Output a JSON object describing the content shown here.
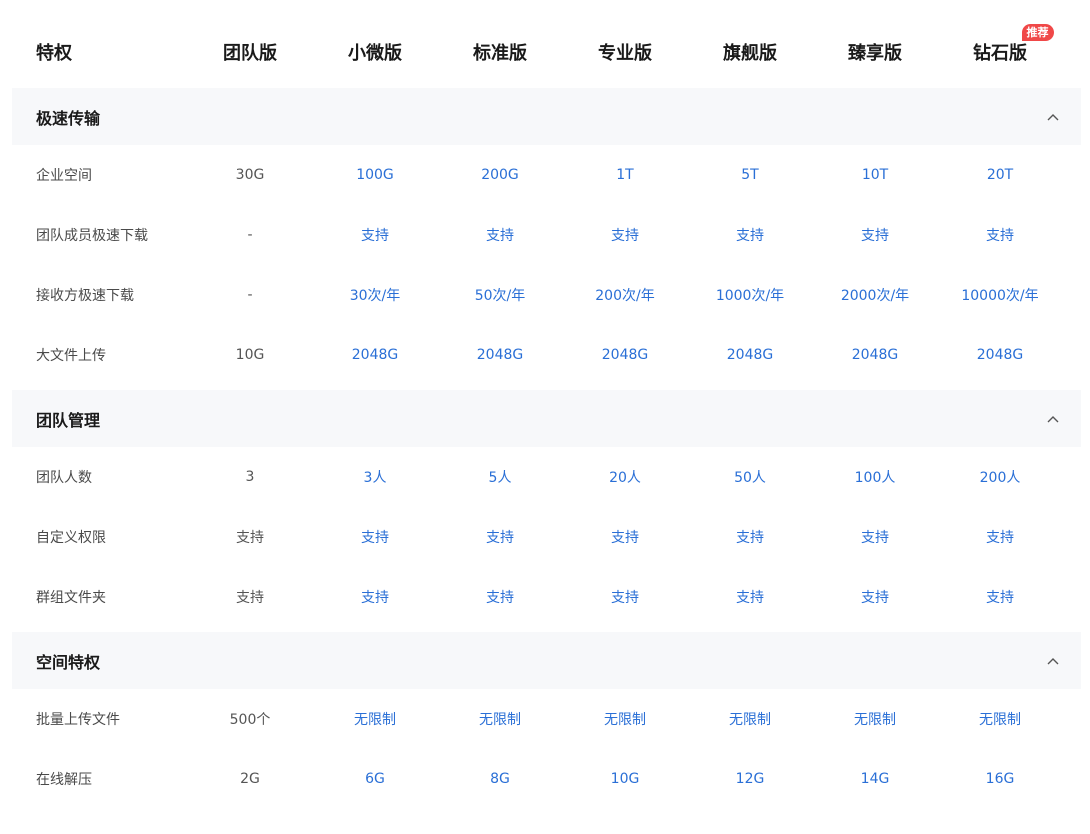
{
  "header": {
    "feature_label": "特权",
    "plans": [
      "团队版",
      "小微版",
      "标准版",
      "专业版",
      "旗舰版",
      "臻享版",
      "钻石版"
    ],
    "recommend_badge": "推荐"
  },
  "colors": {
    "accent_blue": "#2a6fd6",
    "badge_red": "#f04848",
    "section_bg": "#f7f8fa"
  },
  "sections": [
    {
      "title": "极速传输",
      "rows": [
        {
          "label": "企业空间",
          "values": [
            "30G",
            "100G",
            "200G",
            "1T",
            "5T",
            "10T",
            "20T"
          ]
        },
        {
          "label": "团队成员极速下载",
          "values": [
            "-",
            "支持",
            "支持",
            "支持",
            "支持",
            "支持",
            "支持"
          ]
        },
        {
          "label": "接收方极速下载",
          "values": [
            "-",
            "30次/年",
            "50次/年",
            "200次/年",
            "1000次/年",
            "2000次/年",
            "10000次/年"
          ]
        },
        {
          "label": "大文件上传",
          "values": [
            "10G",
            "2048G",
            "2048G",
            "2048G",
            "2048G",
            "2048G",
            "2048G"
          ]
        }
      ]
    },
    {
      "title": "团队管理",
      "rows": [
        {
          "label": "团队人数",
          "values": [
            "3",
            "3人",
            "5人",
            "20人",
            "50人",
            "100人",
            "200人"
          ]
        },
        {
          "label": "自定义权限",
          "values": [
            "支持",
            "支持",
            "支持",
            "支持",
            "支持",
            "支持",
            "支持"
          ]
        },
        {
          "label": "群组文件夹",
          "values": [
            "支持",
            "支持",
            "支持",
            "支持",
            "支持",
            "支持",
            "支持"
          ]
        }
      ]
    },
    {
      "title": "空间特权",
      "rows": [
        {
          "label": "批量上传文件",
          "values": [
            "500个",
            "无限制",
            "无限制",
            "无限制",
            "无限制",
            "无限制",
            "无限制"
          ]
        },
        {
          "label": "在线解压",
          "values": [
            "2G",
            "6G",
            "8G",
            "10G",
            "12G",
            "14G",
            "16G"
          ]
        }
      ]
    }
  ]
}
